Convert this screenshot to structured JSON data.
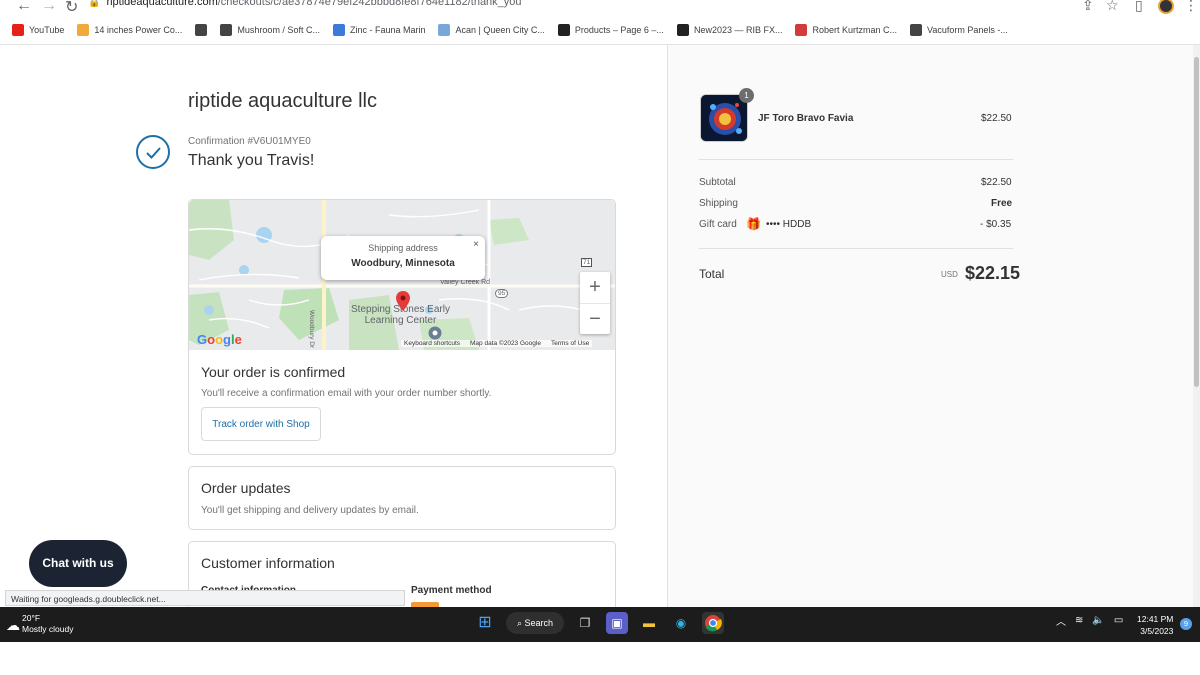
{
  "browser": {
    "url_host": "riptideaquaculture.com",
    "url_path": "/checkouts/c/ae37874e79ef242bbbd8fe8f764e1182/thank_you",
    "bookmarks": [
      {
        "label": "YouTube",
        "icon": "youtube-icon",
        "color": "#e62117"
      },
      {
        "label": "14 inches Power Co...",
        "icon": "bookmark-icon",
        "color": "#f2a93b"
      },
      {
        "label": "",
        "icon": "globe-icon",
        "color": "#444444"
      },
      {
        "label": "Mushroom / Soft C...",
        "icon": "globe-icon",
        "color": "#444444"
      },
      {
        "label": "Zinc - Fauna Marin",
        "icon": "bookmark-icon",
        "color": "#3d7bd9"
      },
      {
        "label": "Acan | Queen City C...",
        "icon": "bookmark-icon",
        "color": "#7aa7d9"
      },
      {
        "label": "Products – Page 6 –...",
        "icon": "bookmark-icon",
        "color": "#222222"
      },
      {
        "label": "New2023 — RIB FX...",
        "icon": "bookmark-icon",
        "color": "#222222"
      },
      {
        "label": "Robert Kurtzman C...",
        "icon": "bookmark-icon",
        "color": "#d23b3b"
      },
      {
        "label": "Vacuform Panels -...",
        "icon": "globe-icon",
        "color": "#444444"
      }
    ]
  },
  "checkout": {
    "store_name": "riptide aquaculture llc",
    "confirmation_number": "Confirmation #V6U01MYE0",
    "thank_you": "Thank you Travis!",
    "map": {
      "popup_title": "Shipping address",
      "popup_city": "Woodbury, Minnesota",
      "close": "×",
      "zoom_in": "+",
      "zoom_out": "−",
      "place_label": "Stepping Stones Early\nLearning Center",
      "road_label": "Valley Creek Rd",
      "route_95": "95",
      "route_71": "71",
      "woodbury_dr": "Woodbury Dr",
      "google": "Google",
      "keyboard_shortcuts": "Keyboard shortcuts",
      "map_data": "Map data ©2023 Google",
      "terms": "Terms of Use"
    },
    "order_confirmed_title": "Your order is confirmed",
    "order_confirmed_text": "You'll receive a confirmation email with your order number shortly.",
    "track_button": "Track order with Shop",
    "updates_title": "Order updates",
    "updates_text": "You'll get shipping and delivery updates by email.",
    "customer_title": "Customer information",
    "contact_label": "Contact information",
    "payment_label": "Payment method"
  },
  "chat": {
    "label": "Chat with us"
  },
  "status": {
    "text": "Waiting for googleads.g.doubleclick.net..."
  },
  "summary": {
    "item_name": "JF Toro Bravo Favia",
    "item_qty": "1",
    "item_price": "$22.50",
    "subtotal_label": "Subtotal",
    "subtotal_value": "$22.50",
    "shipping_label": "Shipping",
    "shipping_value": "Free",
    "giftcard_label": "Gift card",
    "giftcard_code": "•••• HDDB",
    "giftcard_value": "- $0.35",
    "total_label": "Total",
    "currency": "USD",
    "total_value": "$22.15"
  },
  "taskbar": {
    "temp": "20°F",
    "weather": "Mostly cloudy",
    "search": "Search",
    "time": "12:41 PM",
    "date": "3/5/2023",
    "notifications": "9"
  }
}
